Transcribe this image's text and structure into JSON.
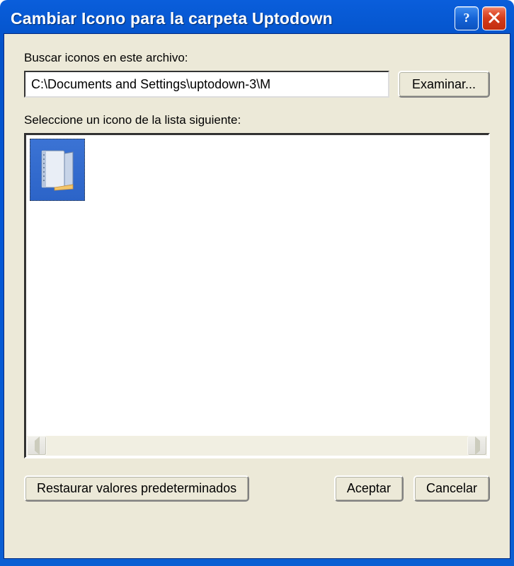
{
  "titlebar": {
    "title": "Cambiar Icono para la carpeta Uptodown",
    "help_icon": "help-icon",
    "close_icon": "close-icon"
  },
  "labels": {
    "file_label": "Buscar iconos en este archivo:",
    "list_label": "Seleccione un icono de la lista siguiente:"
  },
  "file_input": {
    "value": "C:\\Documents and Settings\\uptodown-3\\M"
  },
  "buttons": {
    "browse": "Examinar...",
    "restore": "Restaurar valores predeterminados",
    "ok": "Aceptar",
    "cancel": "Cancelar"
  },
  "icon_list": {
    "items": [
      {
        "name": "folder-icon",
        "selected": true
      }
    ]
  }
}
